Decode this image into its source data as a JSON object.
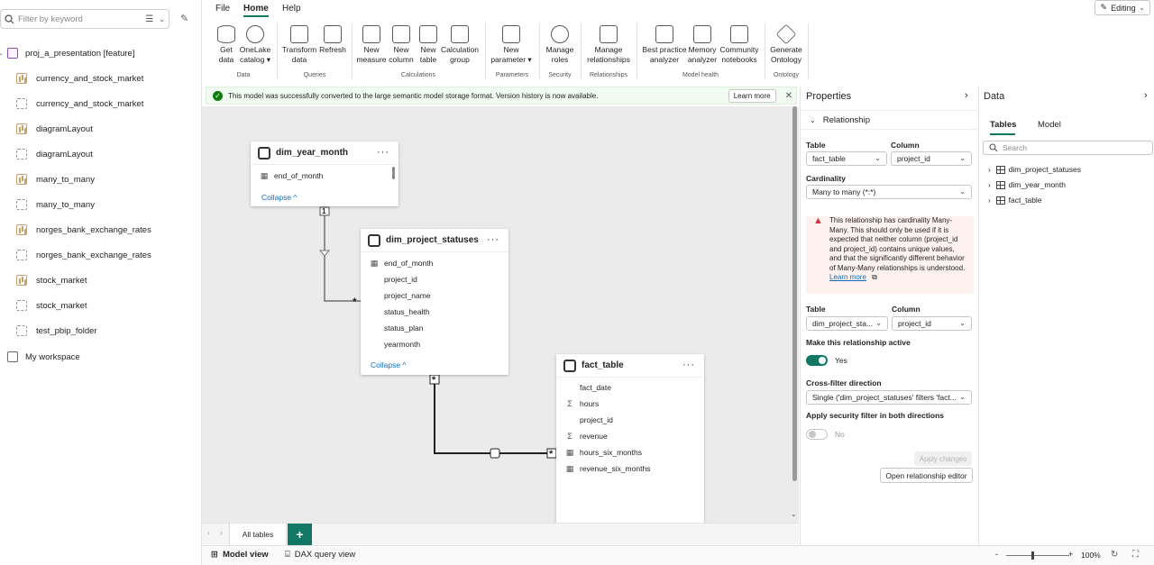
{
  "left_nav": {
    "filter_placeholder": "Filter by keyword",
    "items": [
      {
        "label": "proj_a_presentation [feature]",
        "icon": "workspace-icon"
      },
      {
        "label": "currency_and_stock_market",
        "icon": "report-icon"
      },
      {
        "label": "currency_and_stock_market",
        "icon": "semantic-model-icon"
      },
      {
        "label": "diagramLayout",
        "icon": "report-icon"
      },
      {
        "label": "diagramLayout",
        "icon": "semantic-model-icon"
      },
      {
        "label": "many_to_many",
        "icon": "report-icon"
      },
      {
        "label": "many_to_many",
        "icon": "semantic-model-icon"
      },
      {
        "label": "norges_bank_exchange_rates",
        "icon": "report-icon"
      },
      {
        "label": "norges_bank_exchange_rates",
        "icon": "semantic-model-icon"
      },
      {
        "label": "stock_market",
        "icon": "report-icon"
      },
      {
        "label": "stock_market",
        "icon": "semantic-model-icon"
      },
      {
        "label": "test_pbip_folder",
        "icon": "semantic-model-icon"
      },
      {
        "label": "My workspace",
        "icon": "my-workspace-icon"
      }
    ]
  },
  "menu": {
    "file": "File",
    "home": "Home",
    "help": "Help",
    "editing": "Editing"
  },
  "ribbon": {
    "buttons": [
      {
        "l1": "Get",
        "l2": "data"
      },
      {
        "l1": "OneLake",
        "l2": "catalog ▾"
      },
      {
        "l1": "Transform",
        "l2": "data"
      },
      {
        "l1": "Refresh",
        "l2": ""
      },
      {
        "l1": "New",
        "l2": "measure"
      },
      {
        "l1": "New",
        "l2": "column"
      },
      {
        "l1": "New",
        "l2": "table"
      },
      {
        "l1": "Calculation",
        "l2": "group"
      },
      {
        "l1": "New",
        "l2": "parameter ▾"
      },
      {
        "l1": "Manage",
        "l2": "roles"
      },
      {
        "l1": "Manage",
        "l2": "relationships"
      },
      {
        "l1": "Best practice",
        "l2": "analyzer"
      },
      {
        "l1": "Memory",
        "l2": "analyzer"
      },
      {
        "l1": "Community",
        "l2": "notebooks"
      },
      {
        "l1": "Generate",
        "l2": "Ontology"
      }
    ],
    "groups": [
      "Data",
      "Queries",
      "Calculations",
      "Parameters",
      "Security",
      "Relationships",
      "Model health",
      "Ontology"
    ]
  },
  "infobar": {
    "message": "This model was successfully converted to the large semantic model storage format. Version history is now available.",
    "learn_more": "Learn more"
  },
  "diagram": {
    "tables": [
      {
        "name": "dim_year_month",
        "columns": [
          {
            "name": "end_of_month",
            "icon": "calendar-icon"
          }
        ],
        "collapse": "Collapse ^"
      },
      {
        "name": "dim_project_statuses",
        "columns": [
          {
            "name": "end_of_month",
            "icon": "calendar-icon"
          },
          {
            "name": "project_id",
            "icon": ""
          },
          {
            "name": "project_name",
            "icon": ""
          },
          {
            "name": "status_health",
            "icon": ""
          },
          {
            "name": "status_plan",
            "icon": ""
          },
          {
            "name": "yearmonth",
            "icon": ""
          }
        ],
        "collapse": "Collapse ^"
      },
      {
        "name": "fact_table",
        "columns": [
          {
            "name": "fact_date",
            "icon": ""
          },
          {
            "name": "hours",
            "icon": "sigma-icon"
          },
          {
            "name": "project_id",
            "icon": ""
          },
          {
            "name": "revenue",
            "icon": "sigma-icon"
          },
          {
            "name": "hours_six_months",
            "icon": "measure-table-icon"
          },
          {
            "name": "revenue_six_months",
            "icon": "measure-table-icon"
          }
        ]
      }
    ],
    "markers": {
      "one": "1",
      "many": "*"
    }
  },
  "bottom": {
    "tab_all_tables": "All tables",
    "add_tab": "+",
    "model_view": "Model view",
    "dax_query_view": "DAX query view",
    "zoom": "100%"
  },
  "properties": {
    "title": "Properties",
    "section": "Relationship",
    "table_label": "Table",
    "column_label": "Column",
    "table1": "fact_table",
    "column1": "project_id",
    "cardinality_label": "Cardinality",
    "cardinality": "Many to many (*:*)",
    "warning": "This relationship has cardinality Many-Many. This should only be used if it is expected that neither column (project_id and project_id) contains unique values, and that the significantly different behavior of Many-Many relationships is understood.",
    "warning_link": "Learn more",
    "table2": "dim_project_sta...",
    "column2": "project_id",
    "active_label": "Make this relationship active",
    "active_value": "Yes",
    "crossfilter_label": "Cross-filter direction",
    "crossfilter": "Single ('dim_project_statuses' filters 'fact...",
    "security_label": "Apply security filter in both directions",
    "security_value": "No",
    "apply_changes": "Apply changes",
    "open_editor": "Open relationship editor"
  },
  "data_pane": {
    "title": "Data",
    "tab_tables": "Tables",
    "tab_model": "Model",
    "search_placeholder": "Search",
    "items": [
      "dim_project_statuses",
      "dim_year_month",
      "fact_table"
    ]
  },
  "colors": {
    "accent": "#117865",
    "link": "#0f6cbd",
    "warning": "#d13438",
    "success": "#107c10"
  }
}
